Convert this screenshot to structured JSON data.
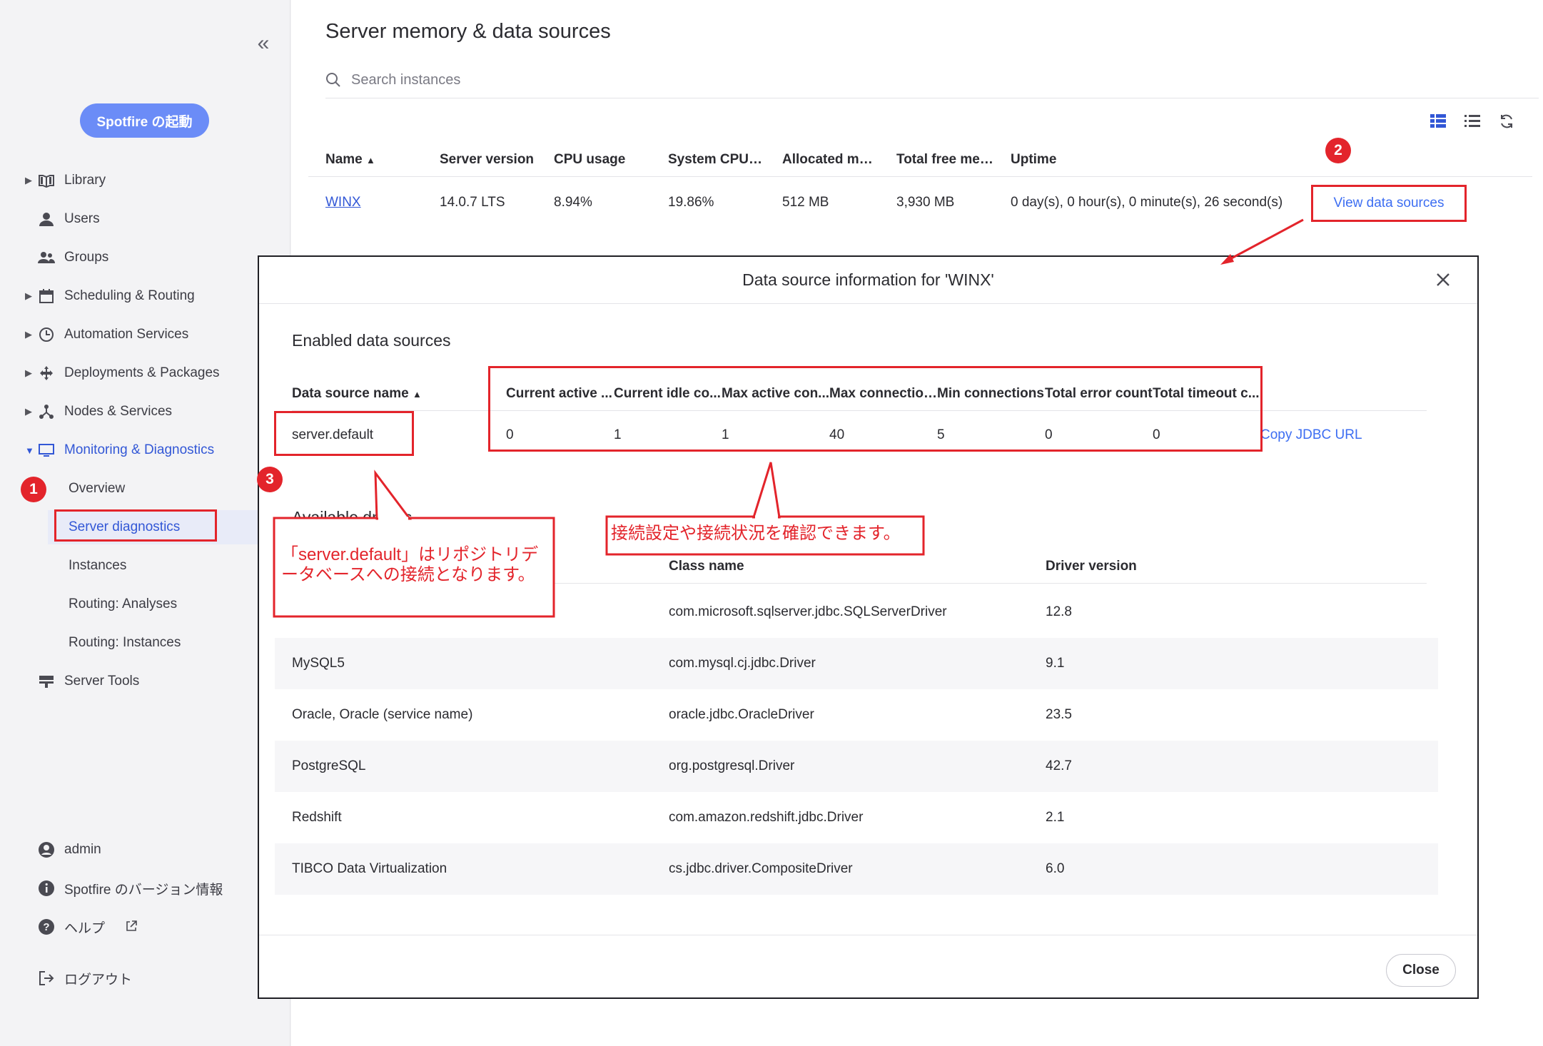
{
  "sidebar": {
    "launch_label": "Spotfire の起動",
    "nav": [
      {
        "label": "Library",
        "icon": "book-icon",
        "caret": "▶"
      },
      {
        "label": "Users",
        "icon": "user-icon",
        "caret": ""
      },
      {
        "label": "Groups",
        "icon": "group-icon",
        "caret": ""
      },
      {
        "label": "Scheduling & Routing",
        "icon": "calendar-icon",
        "caret": "▶"
      },
      {
        "label": "Automation Services",
        "icon": "clock-icon",
        "caret": "▶"
      },
      {
        "label": "Deployments & Packages",
        "icon": "move-icon",
        "caret": "▶"
      },
      {
        "label": "Nodes & Services",
        "icon": "nodes-icon",
        "caret": "▶"
      },
      {
        "label": "Monitoring & Diagnostics",
        "icon": "monitor-icon",
        "caret": "▼"
      }
    ],
    "sub": [
      "Overview",
      "Server diagnostics",
      "Instances",
      "Routing: Analyses",
      "Routing: Instances"
    ],
    "server_tools": "Server Tools",
    "bottom": {
      "admin": "admin",
      "version": "Spotfire のバージョン情報",
      "help": "ヘルプ",
      "logout": "ログアウト"
    }
  },
  "main": {
    "title": "Server memory & data sources",
    "search_placeholder": "Search instances",
    "columns": [
      "Name",
      "Server version",
      "CPU usage",
      "System CPU usa...",
      "Allocated memo...",
      "Total free memo...",
      "Uptime"
    ],
    "row": {
      "name": "WINX",
      "version": "14.0.7 LTS",
      "cpu": "8.94%",
      "sys_cpu": "19.86%",
      "alloc": "512 MB",
      "free": "3,930 MB",
      "uptime": "0 day(s), 0 hour(s), 0 minute(s), 26 second(s)",
      "action": "View data sources"
    }
  },
  "dialog": {
    "title": "Data source information for 'WINX'",
    "enabled_title": "Enabled data sources",
    "enabled_columns": [
      "Data source name",
      "Current active ...",
      "Current idle co...",
      "Max active con...",
      "Max connections",
      "Min connections",
      "Total error count",
      "Total timeout c..."
    ],
    "enabled_row": {
      "name": "server.default",
      "values": [
        "0",
        "1",
        "1",
        "40",
        "5",
        "0",
        "0"
      ],
      "action": "Copy JDBC URL"
    },
    "available_title": "Available drivers",
    "drivers_columns": [
      "Class name",
      "Driver version"
    ],
    "drivers": [
      {
        "name": "",
        "cls": "com.microsoft.sqlserver.jdbc.SQLServerDriver",
        "ver": "12.8"
      },
      {
        "name": "MySQL5",
        "cls": "com.mysql.cj.jdbc.Driver",
        "ver": "9.1"
      },
      {
        "name": "Oracle, Oracle (service name)",
        "cls": "oracle.jdbc.OracleDriver",
        "ver": "23.5"
      },
      {
        "name": "PostgreSQL",
        "cls": "org.postgresql.Driver",
        "ver": "42.7"
      },
      {
        "name": "Redshift",
        "cls": "com.amazon.redshift.jdbc.Driver",
        "ver": "2.1"
      },
      {
        "name": "TIBCO Data Virtualization",
        "cls": "cs.jdbc.driver.CompositeDriver",
        "ver": "6.0"
      }
    ],
    "close_label": "Close"
  },
  "annotations": {
    "badge1": "1",
    "badge2": "2",
    "badge3": "3",
    "callout_left": "「server.default」はリポジトリデータベースへの接続となります。",
    "callout_right": "接続設定や接続状況を確認できます。",
    "color": "#e3242b"
  }
}
